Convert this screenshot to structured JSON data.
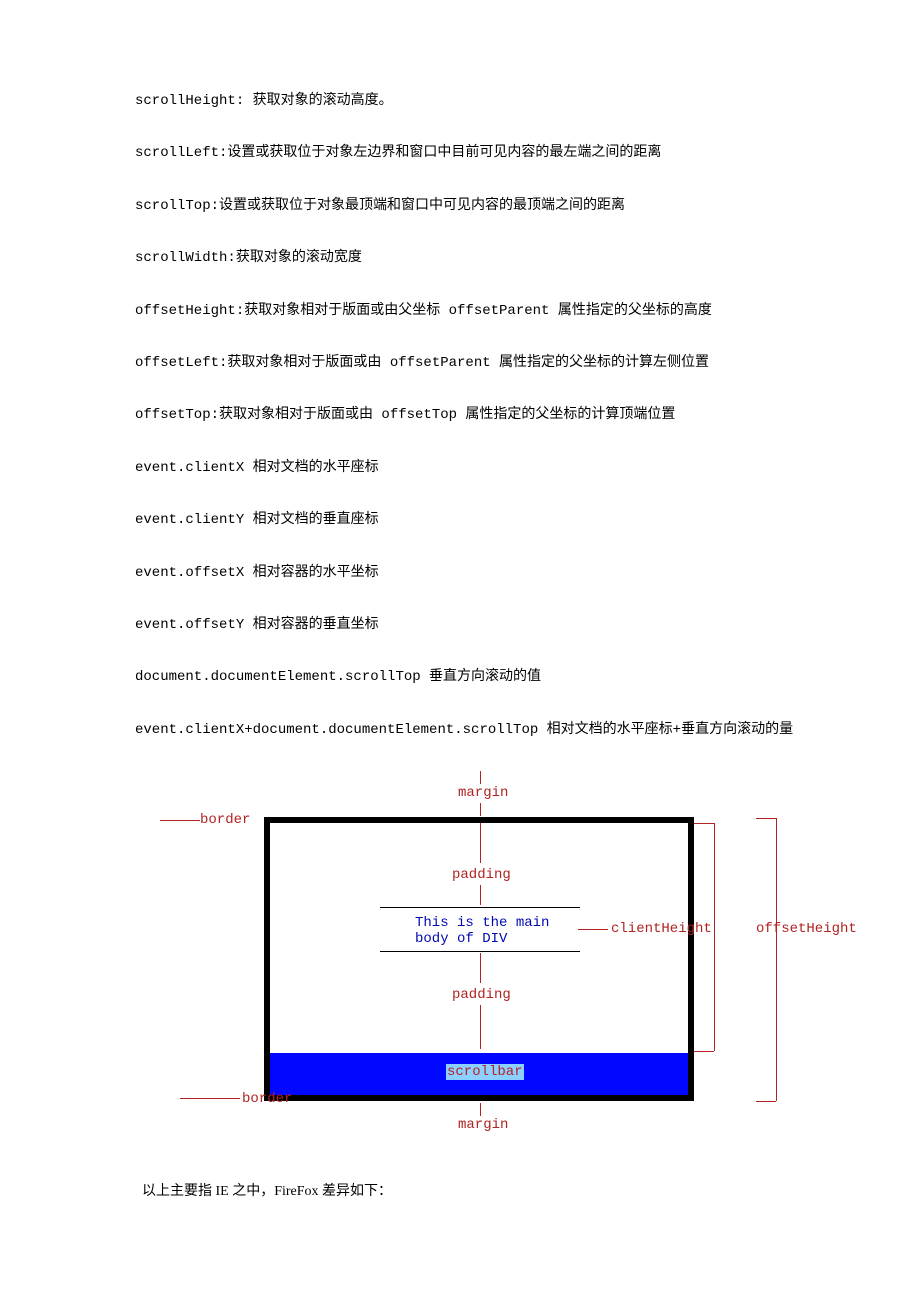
{
  "definitions": [
    "scrollHeight: 获取对象的滚动高度。",
    "scrollLeft:设置或获取位于对象左边界和窗口中目前可见内容的最左端之间的距离",
    "scrollTop:设置或获取位于对象最顶端和窗口中可见内容的最顶端之间的距离",
    "scrollWidth:获取对象的滚动宽度",
    "offsetHeight:获取对象相对于版面或由父坐标 offsetParent 属性指定的父坐标的高度",
    "offsetLeft:获取对象相对于版面或由 offsetParent 属性指定的父坐标的计算左侧位置",
    "offsetTop:获取对象相对于版面或由 offsetTop 属性指定的父坐标的计算顶端位置",
    "event.clientX 相对文档的水平座标",
    "event.clientY 相对文档的垂直座标",
    "event.offsetX 相对容器的水平坐标",
    "event.offsetY 相对容器的垂直坐标",
    "document.documentElement.scrollTop 垂直方向滚动的值",
    "event.clientX+document.documentElement.scrollTop 相对文档的水平座标+垂直方向滚动的量"
  ],
  "diagram": {
    "margin_top": "margin",
    "border_top": "border",
    "padding_top": "padding",
    "body_text_line1": "This is the main",
    "body_text_line2": "body of DIV",
    "padding_bottom": "padding",
    "scrollbar": "scrollbar",
    "border_bottom": "border",
    "margin_bottom": "margin",
    "clientHeight": "clientHeight",
    "offsetHeight": "offsetHeight"
  },
  "footer": "以上主要指 IE 之中，FireFox 差异如下："
}
